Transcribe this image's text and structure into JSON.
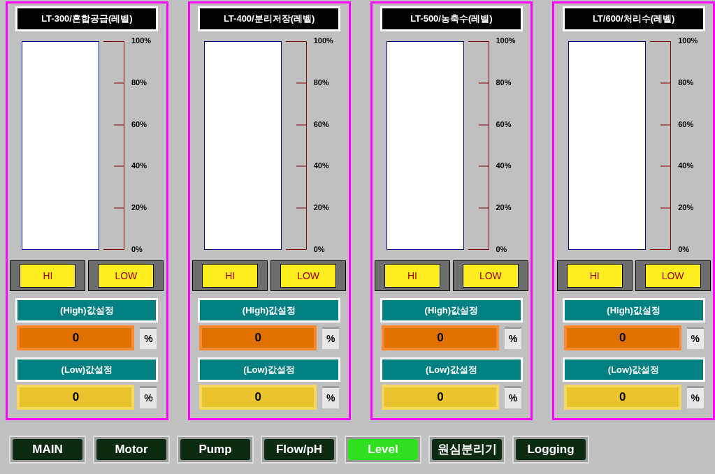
{
  "tanks": [
    {
      "title": "LT-300/혼합공급(레벨)",
      "level": 0,
      "scale": [
        "100%",
        "80%",
        "60%",
        "40%",
        "20%",
        "0%"
      ],
      "hi_button": "HI",
      "low_button": "LOW",
      "high_label": "(High)값설정",
      "high_value": "0",
      "high_unit": "%",
      "low_label": "(Low)값설정",
      "low_value": "0",
      "low_unit": "%"
    },
    {
      "title": "LT-400/분리저장(레벨)",
      "level": 0,
      "scale": [
        "100%",
        "80%",
        "60%",
        "40%",
        "20%",
        "0%"
      ],
      "hi_button": "HI",
      "low_button": "LOW",
      "high_label": "(High)값설정",
      "high_value": "0",
      "high_unit": "%",
      "low_label": "(Low)값설정",
      "low_value": "0",
      "low_unit": "%"
    },
    {
      "title": "LT-500/농축수(레벨)",
      "level": 0,
      "scale": [
        "100%",
        "80%",
        "60%",
        "40%",
        "20%",
        "0%"
      ],
      "hi_button": "HI",
      "low_button": "LOW",
      "high_label": "(High)값설정",
      "high_value": "0",
      "high_unit": "%",
      "low_label": "(Low)값설정",
      "low_value": "0",
      "low_unit": "%"
    },
    {
      "title": "LT/600/처리수(레벨)",
      "level": 0,
      "scale": [
        "100%",
        "80%",
        "60%",
        "40%",
        "20%",
        "0%"
      ],
      "hi_button": "HI",
      "low_button": "LOW",
      "high_label": "(High)값설정",
      "high_value": "0",
      "high_unit": "%",
      "low_label": "(Low)값설정",
      "low_value": "0",
      "low_unit": "%"
    }
  ],
  "nav": [
    {
      "label": "MAIN",
      "selected": false
    },
    {
      "label": "Motor",
      "selected": false
    },
    {
      "label": "Pump",
      "selected": false
    },
    {
      "label": "Flow/pH",
      "selected": false
    },
    {
      "label": "Level",
      "selected": true
    },
    {
      "label": "원심분리기",
      "selected": false
    },
    {
      "label": "Logging",
      "selected": false
    }
  ]
}
